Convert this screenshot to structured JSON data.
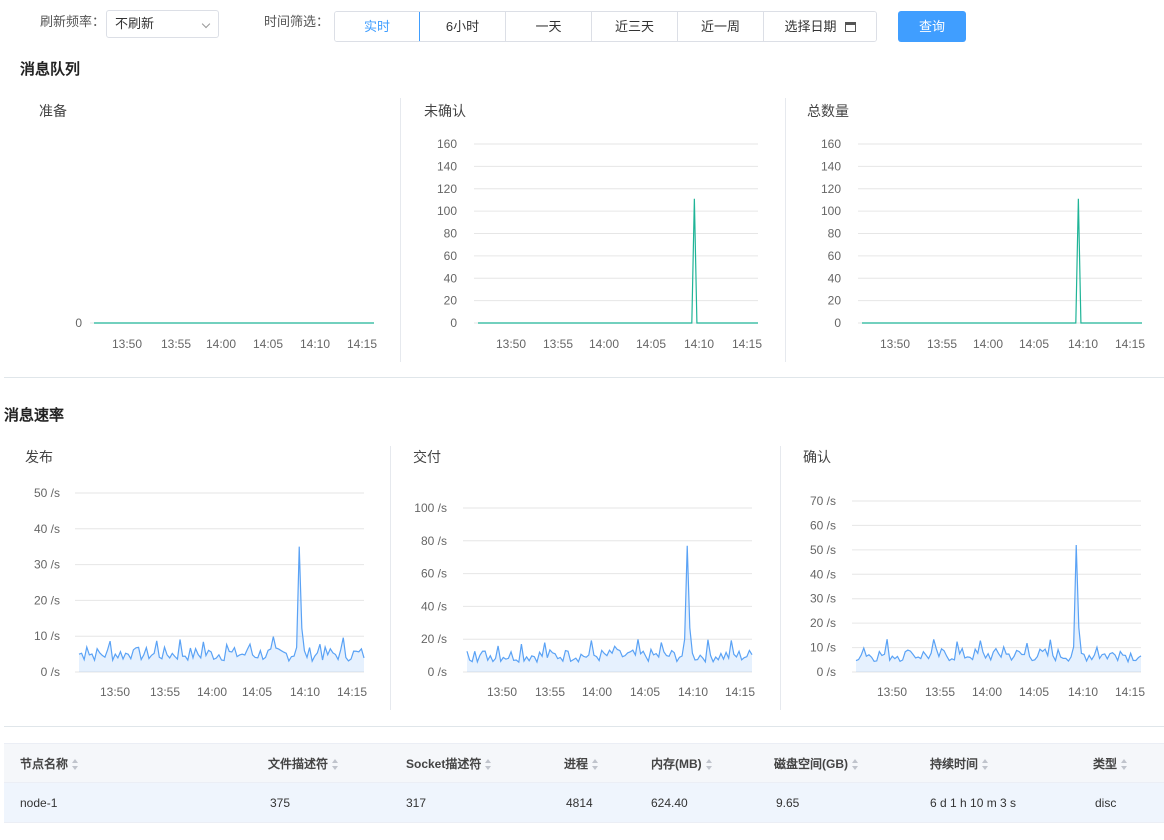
{
  "toolbar": {
    "refresh_label": "刷新频率：",
    "refresh_value": "不刷新",
    "time_label": "时间筛选：",
    "time_options": [
      "实时",
      "6小时",
      "一天",
      "近三天",
      "近一周",
      "选择日期"
    ],
    "active_option": "实时",
    "query_label": "查询"
  },
  "colors": {
    "accent": "#409eff",
    "queue_line": "#1fb497",
    "rate_line": "#5aa2f5"
  },
  "sections": {
    "queue_title": "消息队列",
    "rate_title": "消息速率"
  },
  "chart_data": [
    {
      "type": "line",
      "title": "准备",
      "ylim": [
        0,
        0
      ],
      "yticks": [
        "0"
      ],
      "x": [
        "13:50",
        "13:55",
        "14:00",
        "14:05",
        "14:10",
        "14:15"
      ],
      "series": [
        {
          "values": [
            0,
            0,
            0,
            0,
            0,
            0
          ]
        }
      ]
    },
    {
      "type": "line",
      "title": "未确认",
      "ylim": [
        0,
        160
      ],
      "yticks": [
        "160",
        "140",
        "120",
        "100",
        "80",
        "60",
        "40",
        "20",
        "0"
      ],
      "x": [
        "13:50",
        "13:55",
        "14:00",
        "14:05",
        "14:10",
        "14:15"
      ],
      "series": [
        {
          "values": [
            0,
            0,
            0,
            0,
            111,
            0,
            0
          ]
        }
      ]
    },
    {
      "type": "line",
      "title": "总数量",
      "ylim": [
        0,
        160
      ],
      "yticks": [
        "160",
        "140",
        "120",
        "100",
        "80",
        "60",
        "40",
        "20",
        "0"
      ],
      "x": [
        "13:50",
        "13:55",
        "14:00",
        "14:05",
        "14:10",
        "14:15"
      ],
      "series": [
        {
          "values": [
            0,
            0,
            0,
            0,
            111,
            0,
            0
          ]
        }
      ]
    },
    {
      "type": "area",
      "title": "发布",
      "ylim": [
        0,
        50
      ],
      "yticks": [
        "50 /s",
        "40 /s",
        "30 /s",
        "20 /s",
        "10 /s",
        "0 /s"
      ],
      "x": [
        "13:50",
        "13:55",
        "14:00",
        "14:05",
        "14:10",
        "14:15"
      ],
      "series": [
        {
          "values": [
            6,
            12,
            5,
            9,
            12,
            4,
            8,
            35,
            9,
            6,
            4
          ]
        }
      ]
    },
    {
      "type": "area",
      "title": "交付",
      "ylim": [
        0,
        100
      ],
      "yticks": [
        "100 /s",
        "80 /s",
        "60 /s",
        "40 /s",
        "20 /s",
        "0 /s"
      ],
      "x": [
        "13:50",
        "13:55",
        "14:00",
        "14:05",
        "14:10",
        "14:15"
      ],
      "series": [
        {
          "values": [
            6,
            12,
            5,
            9,
            12,
            4,
            8,
            77,
            9,
            6,
            4
          ]
        }
      ]
    },
    {
      "type": "area",
      "title": "确认",
      "ylim": [
        0,
        70
      ],
      "yticks": [
        "70 /s",
        "60 /s",
        "50 /s",
        "40 /s",
        "30 /s",
        "20 /s",
        "10 /s",
        "0 /s"
      ],
      "x": [
        "13:50",
        "13:55",
        "14:00",
        "14:05",
        "14:10",
        "14:15"
      ],
      "series": [
        {
          "values": [
            6,
            12,
            5,
            9,
            12,
            4,
            8,
            52,
            9,
            6,
            4
          ]
        }
      ]
    }
  ],
  "table": {
    "columns": [
      "节点名称",
      "文件描述符",
      "Socket描述符",
      "进程",
      "内存(MB)",
      "磁盘空间(GB)",
      "持续时间",
      "类型"
    ],
    "rows": [
      [
        "node-1",
        "375",
        "317",
        "4814",
        "624.40",
        "9.65",
        "6 d 1 h 10 m 3 s",
        "disc"
      ]
    ]
  }
}
